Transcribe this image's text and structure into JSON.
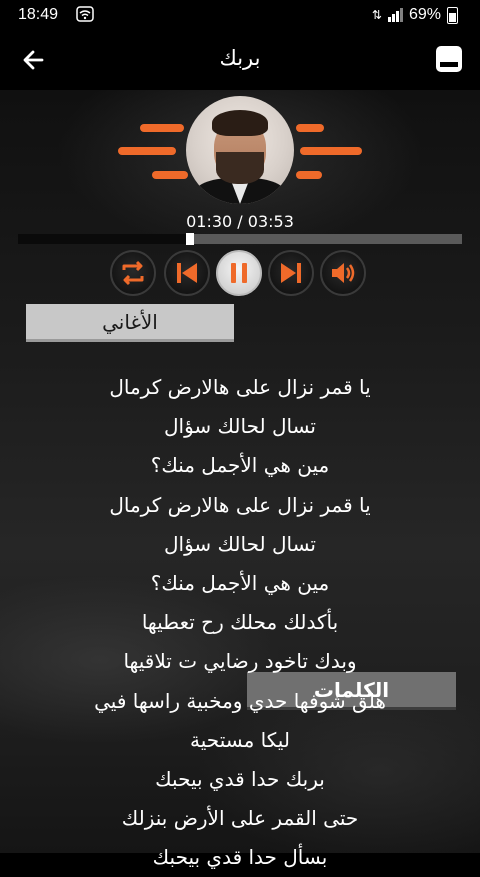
{
  "status_bar": {
    "time": "18:49",
    "battery": "69%"
  },
  "header": {
    "title": "بربك"
  },
  "player": {
    "current_time": "01:30",
    "total_time": "03:53",
    "time_display": "01:30 / 03:53",
    "progress": 0.387,
    "accent_color": "#ef6a2a"
  },
  "tabs": {
    "lyrics_label": "الكلمات",
    "songs_label": "الأغاني",
    "active": "lyrics"
  },
  "lyrics": [
    "يا قمر نزال على هالارض كرمال",
    "تسال لحالك سؤال",
    "مين هي الأجمل منك؟",
    "يا قمر نزال على هالارض كرمال",
    "تسال لحالك سؤال",
    "مين هي الأجمل منك؟",
    "بأكدلك محلك رح تعطيها",
    "وبدك تاخود رضايي ت تلاقيها",
    "هلق شوفها حدي ومخبية راسها فيي",
    "ليكا مستحية",
    "بربك حدا قدي بيحبك",
    "حتى القمر على الأرض بنزلك",
    "بسأل حدا قدي بيحبك"
  ]
}
